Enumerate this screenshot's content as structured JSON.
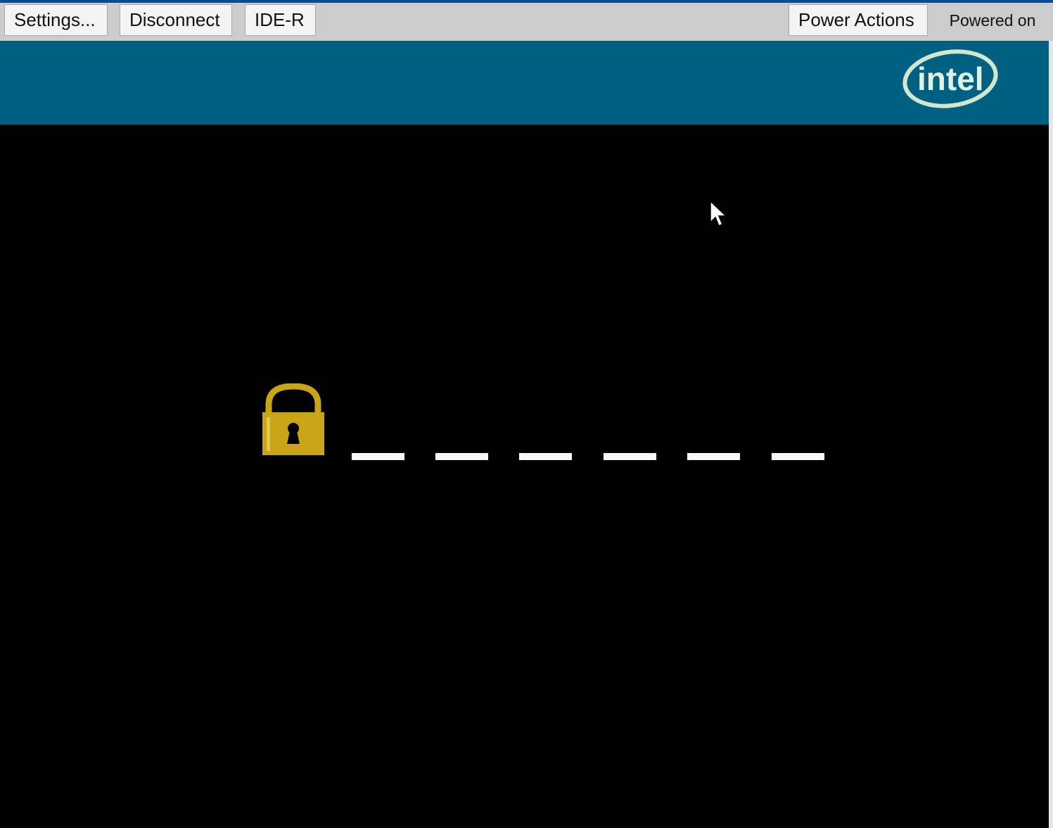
{
  "toolbar": {
    "settings_label": "Settings...",
    "disconnect_label": "Disconnect",
    "ider_label": "IDE-R",
    "power_actions_label": "Power Actions",
    "power_status": "Powered on"
  },
  "banner": {
    "logo_text": "intel",
    "logo_icon": "intel-logo",
    "background_color": "#006082"
  },
  "remote_screen": {
    "lock_icon": "padlock-icon",
    "lock_color": "#c9a416",
    "password_slots": 6,
    "cursor_icon": "mouse-pointer-icon"
  }
}
